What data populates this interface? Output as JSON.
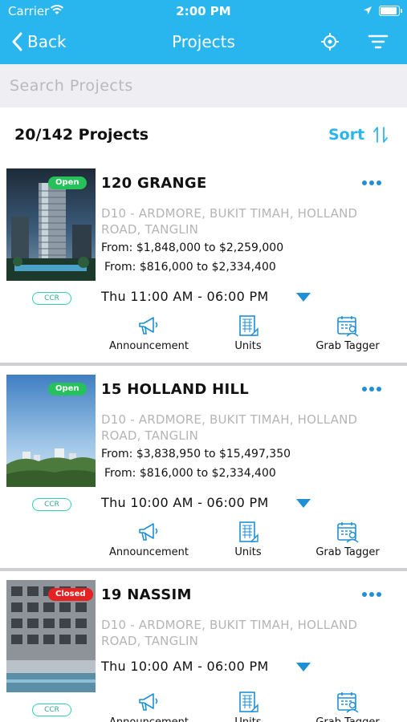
{
  "status_bar": {
    "carrier": "Carrier",
    "time": "2:00 PM"
  },
  "nav": {
    "back_label": "Back",
    "title": "Projects"
  },
  "search": {
    "placeholder": "Search Projects"
  },
  "summary": {
    "count": "20/142  Projects",
    "sort_label": "Sort"
  },
  "actions": {
    "announcement": "Announcement",
    "units": "Units",
    "grab_tagger": "Grab Tagger"
  },
  "colors": {
    "accent": "#29b6ef",
    "open": "#26c15a",
    "closed": "#e52121",
    "region": "#2fd3b4"
  },
  "projects": [
    {
      "status": "Open",
      "name": "120 GRANGE",
      "address": "D10 - ARDMORE, BUKIT TIMAH, HOLLAND ROAD, TANGLIN",
      "price1": "From: $1,848,000 to $2,259,000",
      "price2": "From: $816,000 to $2,334,400",
      "region": "CCR",
      "time": "Thu  11:00 AM  -  06:00 PM"
    },
    {
      "status": "Open",
      "name": "15 HOLLAND HILL",
      "address": "D10 - ARDMORE, BUKIT TIMAH, HOLLAND ROAD, TANGLIN",
      "price1": "From: $3,838,950 to $15,497,350",
      "price2": "From: $816,000 to $2,334,400",
      "region": "CCR",
      "time": "Thu  10:00 AM  -  06:00 PM"
    },
    {
      "status": "Closed",
      "name": "19 NASSIM",
      "address": "D10 - ARDMORE, BUKIT TIMAH, HOLLAND ROAD, TANGLIN",
      "region": "CCR",
      "time": "Thu  10:00 AM  -  06:00 PM"
    }
  ]
}
